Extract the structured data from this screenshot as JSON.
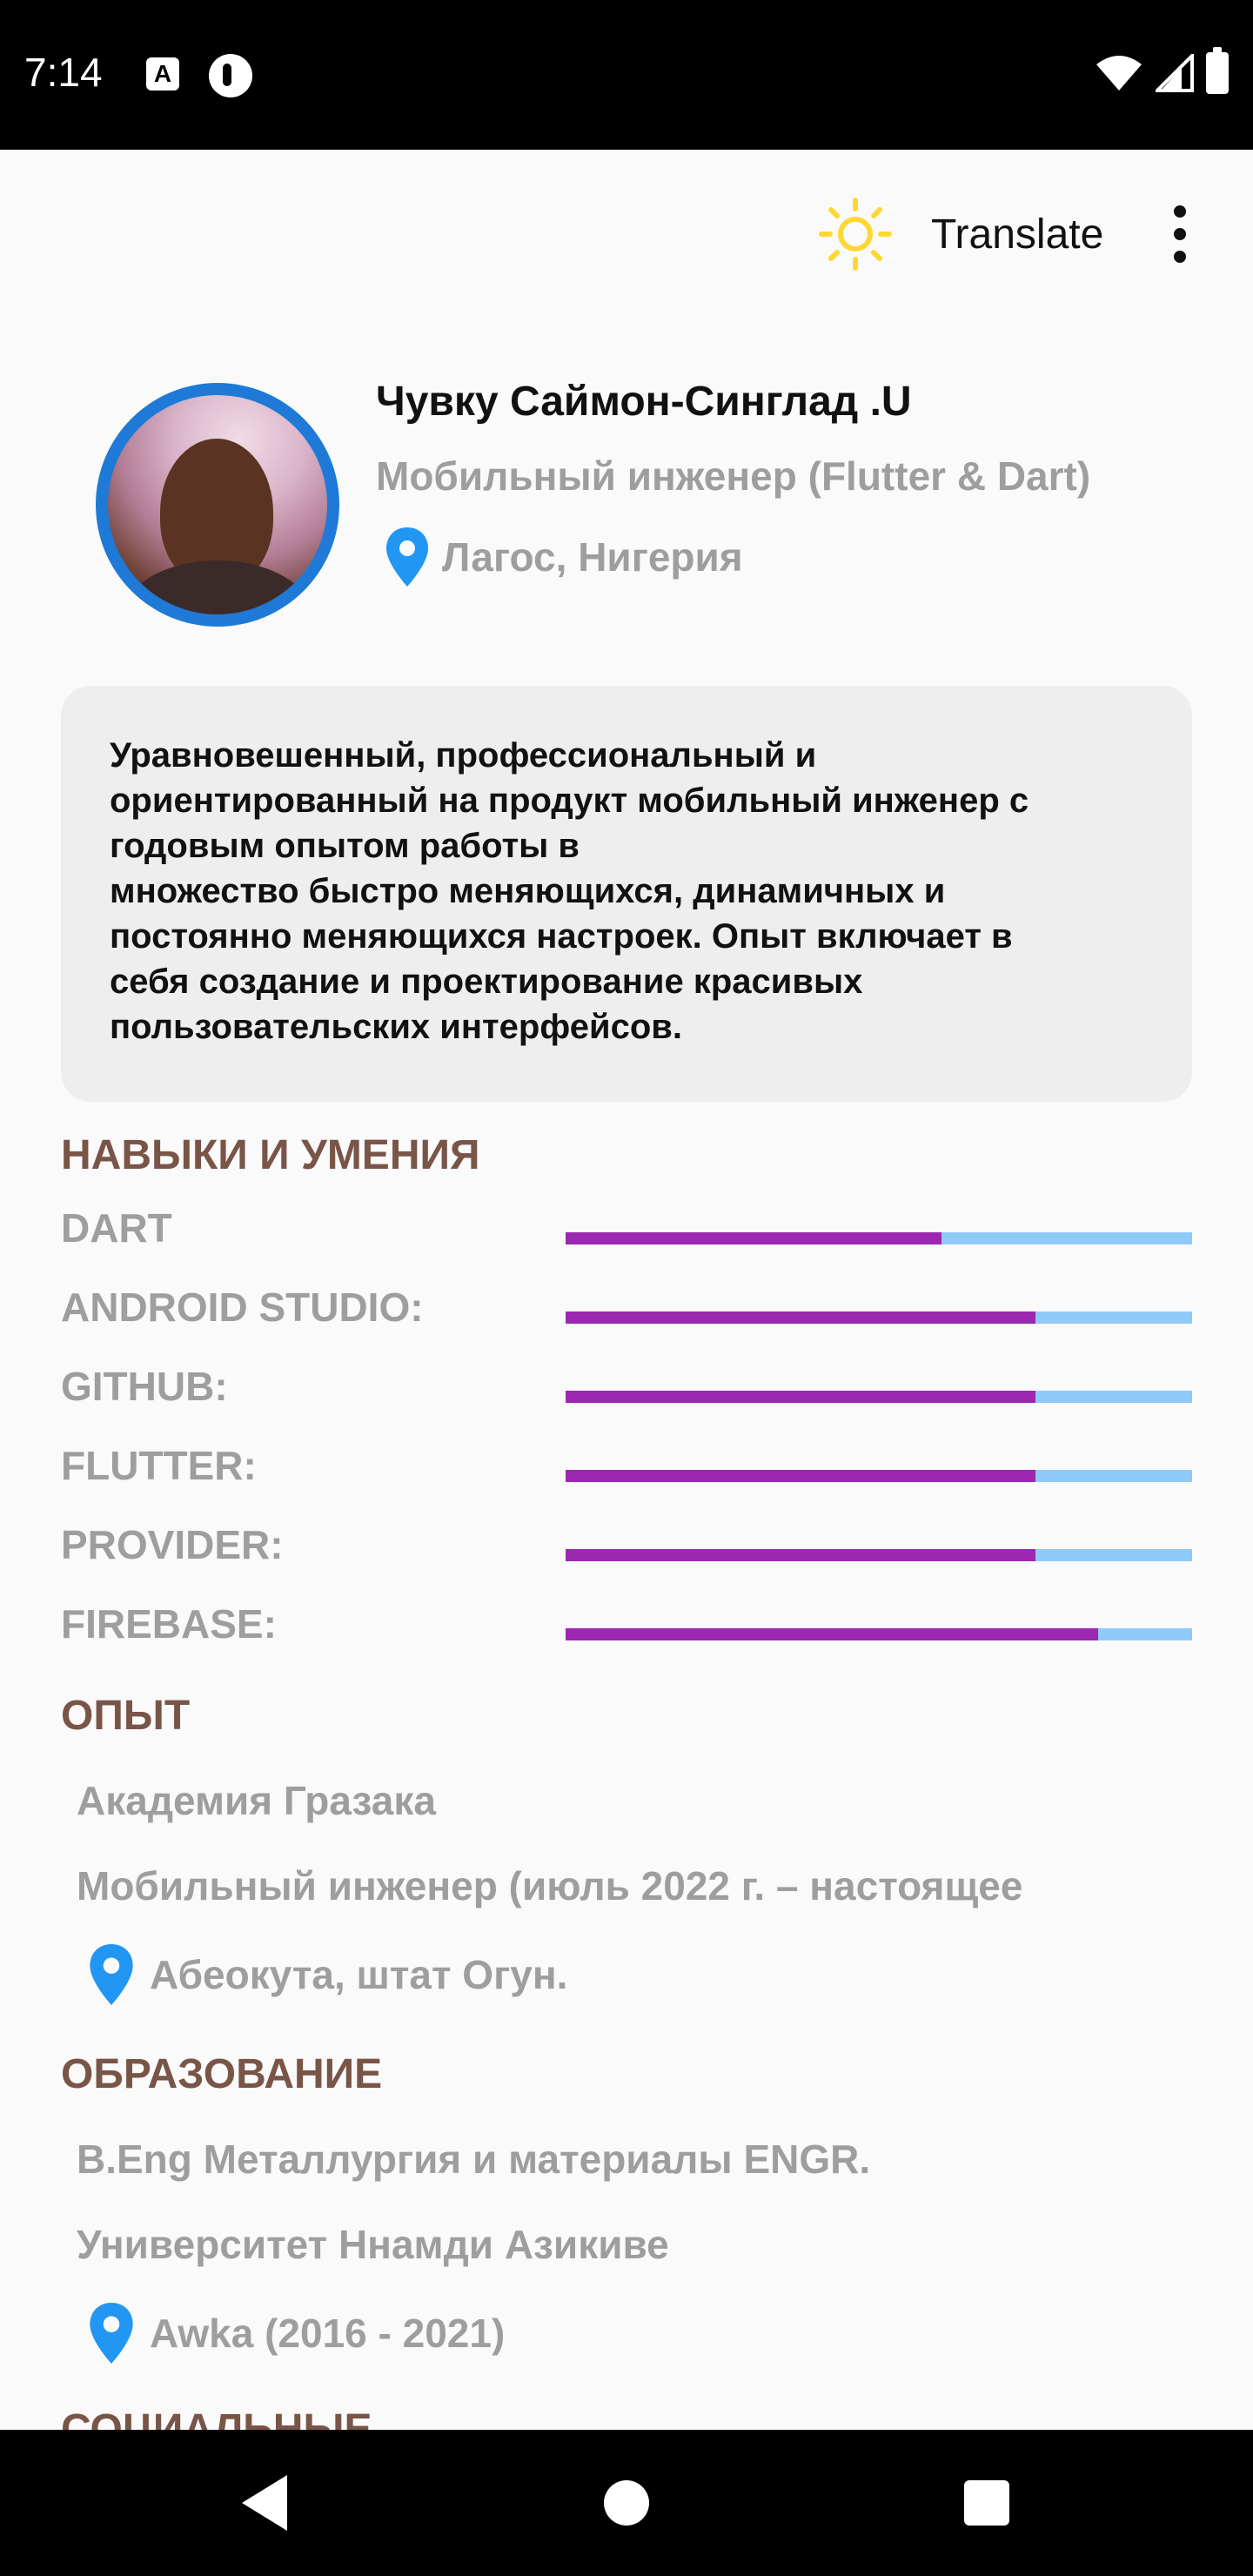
{
  "status_bar": {
    "time": "7:14",
    "app_icon_letter": "A",
    "icons": [
      "a-app-icon",
      "p-app-icon",
      "wifi-icon",
      "signal-icon",
      "battery-icon"
    ]
  },
  "toolbar": {
    "theme_icon": "sun-icon",
    "translate_label": "Translate",
    "more_icon": "more-vert-icon"
  },
  "profile": {
    "name": "Чувку Саймон-Синглад .U",
    "role": "Мобильный инженер (Flutter & Dart)",
    "location": "Лагос, Нигерия"
  },
  "bio": "Уравновешенный, профессиональный и\nориентированный на продукт мобильный инженер с\nгодовым опытом работы в\nмножество быстро меняющихся, динамичных и\nпостоянно меняющихся настроек. Опыт включает в\nсебя создание и проектирование красивых\nпользовательских интерфейсов.",
  "skills": {
    "title": "НАВЫКИ И УМЕНИЯ",
    "items": [
      {
        "label": "DART",
        "level": 0.6
      },
      {
        "label": "ANDROID STUDIO:",
        "level": 0.75
      },
      {
        "label": "GITHUB:",
        "level": 0.75
      },
      {
        "label": "FLUTTER:",
        "level": 0.75
      },
      {
        "label": "PROVIDER:",
        "level": 0.75
      },
      {
        "label": "FIREBASE:",
        "level": 0.85
      }
    ]
  },
  "experience": {
    "title": "ОПЫТ",
    "company": "Академия Гразака",
    "position": "Мобильный инженер (июль 2022 г. – настоящее",
    "location": "Абеокута, штат Огун."
  },
  "education": {
    "title": "ОБРАЗОВАНИЕ",
    "degree": "B.Eng Металлургия и материалы ENGR.",
    "university": "Университет Ннамди Азикиве",
    "location": "Awka (2016 - 2021)"
  },
  "next_section_title_partial": "СОЦИАЛЬНЫЕ",
  "colors": {
    "accent_purple": "#9c27b0",
    "track_blue": "#90caf9",
    "section_brown": "#795548",
    "muted_gray": "#9e9e9e",
    "pin_blue": "#2196f3",
    "avatar_ring": "#1e7ad6",
    "sun_yellow": "#fdd835"
  }
}
